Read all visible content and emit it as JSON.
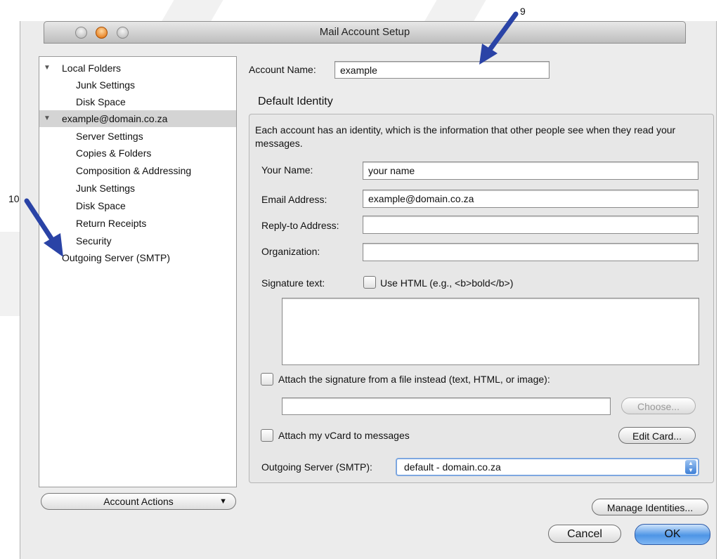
{
  "window": {
    "title": "Mail Account Setup"
  },
  "tree": {
    "items": [
      {
        "label": "Local Folders",
        "level": 0,
        "expanded": true
      },
      {
        "label": "Junk Settings",
        "level": 1
      },
      {
        "label": "Disk Space",
        "level": 1
      },
      {
        "label": "example@domain.co.za",
        "level": 0,
        "expanded": true,
        "selected": true
      },
      {
        "label": "Server Settings",
        "level": 1
      },
      {
        "label": "Copies & Folders",
        "level": 1
      },
      {
        "label": "Composition & Addressing",
        "level": 1
      },
      {
        "label": "Junk Settings",
        "level": 1
      },
      {
        "label": "Disk Space",
        "level": 1
      },
      {
        "label": "Return Receipts",
        "level": 1
      },
      {
        "label": "Security",
        "level": 1
      },
      {
        "label": "Outgoing Server (SMTP)",
        "level": 0
      }
    ],
    "account_actions": "Account Actions"
  },
  "account": {
    "name_label": "Account Name:",
    "name_value": "example"
  },
  "identity": {
    "header": "Default Identity",
    "description": "Each account has an identity, which is the information that other people see when they read your messages.",
    "your_name_label": "Your Name:",
    "your_name_value": "your name",
    "email_label": "Email Address:",
    "email_value": "example@domain.co.za",
    "reply_to_label": "Reply-to Address:",
    "reply_to_value": "",
    "organization_label": "Organization:",
    "organization_value": "",
    "signature_label": "Signature text:",
    "use_html_label": "Use HTML (e.g., <b>bold</b>)",
    "attach_sig_label": "Attach the signature from a file instead (text, HTML, or image):",
    "choose_label": "Choose...",
    "vcard_label": "Attach my vCard to messages",
    "edit_card_label": "Edit Card...",
    "smtp_label": "Outgoing Server (SMTP):",
    "smtp_value": "default - domain.co.za"
  },
  "buttons": {
    "manage_identities": "Manage Identities...",
    "cancel": "Cancel",
    "ok": "OK"
  },
  "callouts": {
    "nine": "9",
    "ten": "10"
  }
}
